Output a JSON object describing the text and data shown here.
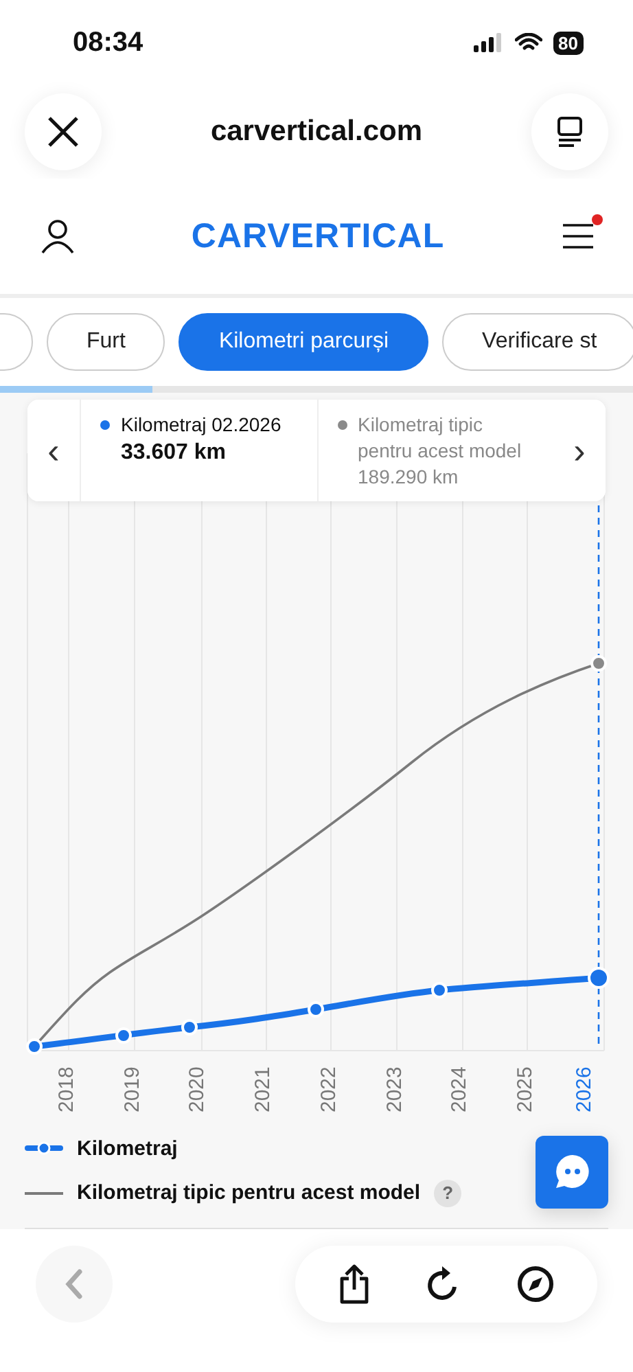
{
  "status_bar": {
    "time": "08:34",
    "battery": "80"
  },
  "browser": {
    "url": "carvertical.com"
  },
  "site_header": {
    "logo": "CARVERTICAL",
    "menu_notification": true
  },
  "tabs": [
    {
      "selected": false
    },
    {
      "label": "Furt",
      "selected": false
    },
    {
      "label": "Kilometri parcurși",
      "selected": true
    },
    {
      "label": "Verificare st",
      "selected": false
    }
  ],
  "tab_progress": {
    "level": 0.24
  },
  "tooltip": {
    "prev": "‹",
    "next": "›",
    "entries": [
      {
        "label": "Kilometraj 02.2026",
        "value": "33.607 km",
        "color": "#1a73e8",
        "muted": false
      },
      {
        "label": "Kilometraj tipic pentru acest model",
        "value": "189.290 km",
        "color": "#8a8a8a",
        "muted": true
      }
    ]
  },
  "chart": {
    "x_labels": [
      {
        "label": "2018",
        "selected": false
      },
      {
        "label": "2019",
        "selected": false
      },
      {
        "label": "2020",
        "selected": false
      },
      {
        "label": "2021",
        "selected": false
      },
      {
        "label": "2022",
        "selected": false
      },
      {
        "label": "2023",
        "selected": false
      },
      {
        "label": "2024",
        "selected": false
      },
      {
        "label": "2025",
        "selected": false
      },
      {
        "label": "2026",
        "selected": true
      }
    ]
  },
  "legend": [
    {
      "kind": "points",
      "label": "Kilometraj"
    },
    {
      "kind": "line",
      "label": "Kilometraj tipic pentru acest model",
      "help": "?"
    }
  ]
}
